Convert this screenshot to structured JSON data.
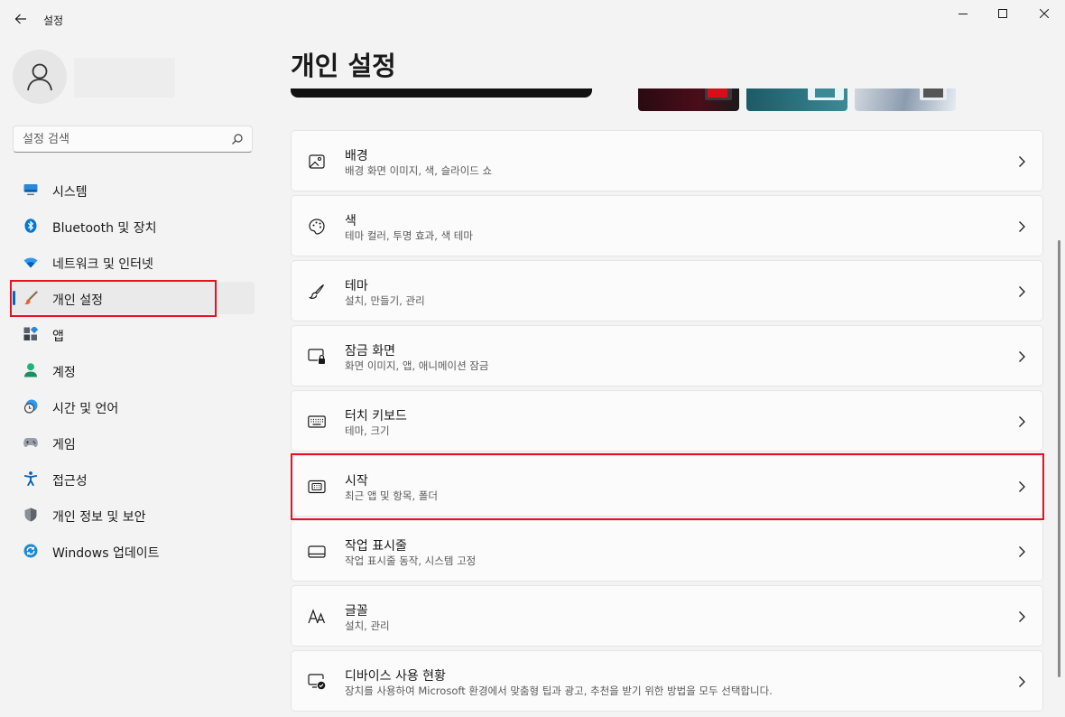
{
  "window": {
    "title": "설정",
    "back_icon": "arrow-left-icon",
    "controls": [
      "minimize-icon",
      "maximize-icon",
      "close-icon"
    ]
  },
  "user": {
    "avatar_icon": "person-icon"
  },
  "search": {
    "placeholder": "설정 검색",
    "icon": "search-icon"
  },
  "sidebar": {
    "items": [
      {
        "label": "시스템",
        "icon": "monitor-icon",
        "selected": false
      },
      {
        "label": "Bluetooth 및 장치",
        "icon": "bluetooth-icon",
        "selected": false
      },
      {
        "label": "네트워크 및 인터넷",
        "icon": "wifi-icon",
        "selected": false
      },
      {
        "label": "개인 설정",
        "icon": "brush-icon",
        "selected": true
      },
      {
        "label": "앱",
        "icon": "apps-icon",
        "selected": false
      },
      {
        "label": "계정",
        "icon": "account-icon",
        "selected": false
      },
      {
        "label": "시간 및 언어",
        "icon": "clock-globe-icon",
        "selected": false
      },
      {
        "label": "게임",
        "icon": "gamepad-icon",
        "selected": false
      },
      {
        "label": "접근성",
        "icon": "accessibility-icon",
        "selected": false
      },
      {
        "label": "개인 정보 및 보안",
        "icon": "shield-icon",
        "selected": false
      },
      {
        "label": "Windows 업데이트",
        "icon": "update-icon",
        "selected": false
      }
    ]
  },
  "main": {
    "title": "개인 설정",
    "cards": [
      {
        "title": "배경",
        "subtitle": "배경 화면 이미지, 색, 슬라이드 쇼",
        "icon": "image-icon"
      },
      {
        "title": "색",
        "subtitle": "테마 컬러, 투명 효과, 색 테마",
        "icon": "palette-icon"
      },
      {
        "title": "테마",
        "subtitle": "설치, 만들기, 관리",
        "icon": "brush-outline-icon"
      },
      {
        "title": "잠금 화면",
        "subtitle": "화면 이미지, 앱, 애니메이션 잠금",
        "icon": "lock-screen-icon"
      },
      {
        "title": "터치 키보드",
        "subtitle": "테마, 크기",
        "icon": "keyboard-icon"
      },
      {
        "title": "시작",
        "subtitle": "최근 앱 및 항목, 폴더",
        "icon": "start-menu-icon"
      },
      {
        "title": "작업 표시줄",
        "subtitle": "작업 표시줄 동작, 시스템 고정",
        "icon": "taskbar-icon"
      },
      {
        "title": "글꼴",
        "subtitle": "설치, 관리",
        "icon": "font-icon"
      },
      {
        "title": "디바이스 사용 현황",
        "subtitle": "장치를 사용하여 Microsoft 환경에서 맞춤형 팁과 광고, 추천을 받기 위한 방법을 모두 선택합니다.",
        "icon": "device-usage-icon"
      }
    ]
  },
  "colors": {
    "accent": "#0067c0",
    "highlight": "#e81123",
    "background": "#f3f3f3",
    "card": "#fbfbfb"
  }
}
